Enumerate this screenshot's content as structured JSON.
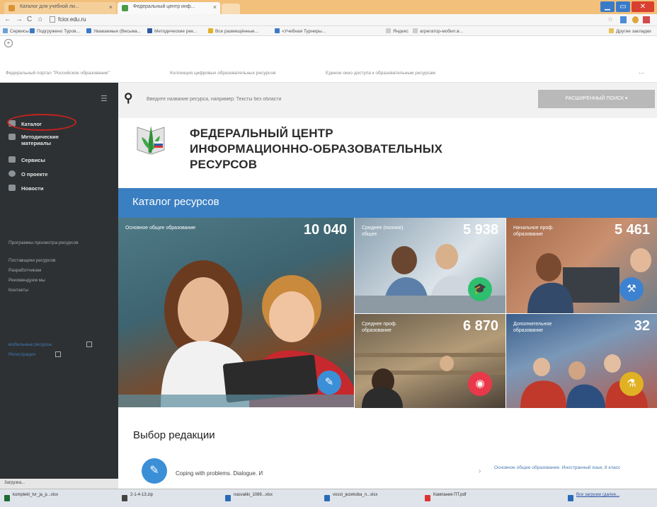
{
  "browser": {
    "tabs": [
      {
        "label": "Каталог для учебной ли..."
      },
      {
        "label": "Федеральный центр инф..."
      }
    ],
    "url": "fcior.edu.ru",
    "bookmarks": [
      "Сервисы",
      "Подгружено Туров...",
      "Уважаемые (Весьма...",
      "Методические рек...",
      "Все размещённые...",
      "«Учебная Турниры...",
      "Яндекс",
      "агрегатор-мобил.в...",
      "Другие закладки"
    ]
  },
  "topnav": {
    "links": [
      "Федеральный портал \"Российское образование\"",
      "Коллекция цифровых образовательных ресурсов",
      "Единое окно доступа к образовательным ресурсам"
    ],
    "more": "..."
  },
  "sidebar": {
    "items": [
      "Каталог",
      "Методические материалы",
      "Сервисы",
      "О проекте",
      "Новости"
    ],
    "links": [
      "Программы просмотра ресурсов",
      "Поставщики ресурсов",
      "Разработчикам",
      "Рекомендуем мы",
      "Контакты"
    ],
    "extra_links": [
      "мобильные ресурсы",
      "Регистрация"
    ]
  },
  "search": {
    "placeholder": "Введите название ресурса, например: Тексты без области",
    "button": "РАСШИРЕННЫЙ ПОИСК"
  },
  "header": {
    "line1": "ФЕДЕРАЛЬНЫЙ ЦЕНТР",
    "line2": "ИНФОРМАЦИОННО-ОБРАЗОВАТЕЛЬНЫХ",
    "line3": "РЕСУРСОВ"
  },
  "catalog": {
    "title": "Каталог ресурсов",
    "tiles": [
      {
        "label": "Основное общее образование",
        "count": "10 040",
        "color": "#3b8fd6"
      },
      {
        "label": "Среднее (полное) общее",
        "count": "5 938",
        "color": "#2dbf6e"
      },
      {
        "label": "Начальное проф. образование",
        "count": "5 461",
        "color": "#3c82d1"
      },
      {
        "label": "Среднее проф. образование",
        "count": "6 870",
        "color": "#e8384a"
      },
      {
        "label": "Дополнительное образование",
        "count": "32",
        "color": "#e0b223"
      }
    ]
  },
  "editors_choice": {
    "title": "Выбор редакции",
    "item": "Coping with problems. Dialogue. И",
    "item_meta": "Основное общее образование. Иностранный язык, 8 класс"
  },
  "taskbar": {
    "items": [
      "komplekt_tvr_ja_p...xlsx",
      "2-1-4-13.zip",
      "nasvaliki_1089...xlsx",
      "vosst_jezekoba_n...xlsx",
      "Кампания ПТ.pdf",
      "Все загрузки (далее..."
    ],
    "status": "Загрузка..."
  }
}
